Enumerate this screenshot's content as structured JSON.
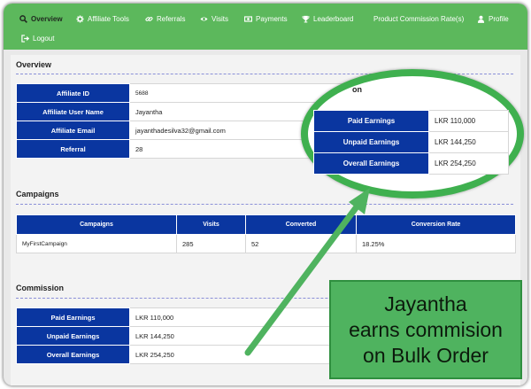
{
  "nav": {
    "items": [
      {
        "label": "Overview",
        "icon": "search-icon",
        "active": true
      },
      {
        "label": "Affiliate Tools",
        "icon": "gear-icon"
      },
      {
        "label": "Referrals",
        "icon": "link-icon"
      },
      {
        "label": "Visits",
        "icon": "eye-icon"
      },
      {
        "label": "Payments",
        "icon": "money-icon"
      },
      {
        "label": "Leaderboard",
        "icon": "trophy-icon"
      },
      {
        "label": "Product Commission Rate(s)",
        "icon": ""
      },
      {
        "label": "Profile",
        "icon": "user-icon"
      },
      {
        "label": "Logout",
        "icon": "logout-icon"
      }
    ]
  },
  "overview": {
    "title": "Overview",
    "rows": [
      {
        "key": "Affiliate ID",
        "value": "5688"
      },
      {
        "key": "Affiliate User Name",
        "value": "Jayantha"
      },
      {
        "key": "Affiliate Email",
        "value": "jayanthadesilva32@gmail.com"
      },
      {
        "key": "Referral",
        "value": "28"
      }
    ]
  },
  "earnings_highlight": {
    "title_fragment": "on",
    "rows": [
      {
        "key": "Paid Earnings",
        "value": "LKR 110,000"
      },
      {
        "key": "Unpaid Earnings",
        "value": "LKR 144,250"
      },
      {
        "key": "Overall Earnings",
        "value": "LKR 254,250"
      }
    ]
  },
  "campaigns": {
    "title": "Campaigns",
    "headers": [
      "Campaigns",
      "Visits",
      "Converted",
      "Conversion Rate"
    ],
    "rows": [
      [
        "MyFirstCampaign",
        "285",
        "52",
        "18.25%"
      ]
    ]
  },
  "commission": {
    "title": "Commission",
    "rows": [
      {
        "key": "Paid Earnings",
        "value": "LKR 110,000"
      },
      {
        "key": "Unpaid Earnings",
        "value": "LKR 144,250"
      },
      {
        "key": "Overall Earnings",
        "value": "LKR 254,250"
      }
    ]
  },
  "callout": {
    "line1": "Jayantha",
    "line2": "earns commision",
    "line3": "on Bulk Order"
  },
  "colors": {
    "navbar": "#5cb85c",
    "table_header": "#0a36a0",
    "highlight_green": "#3fb04f"
  }
}
